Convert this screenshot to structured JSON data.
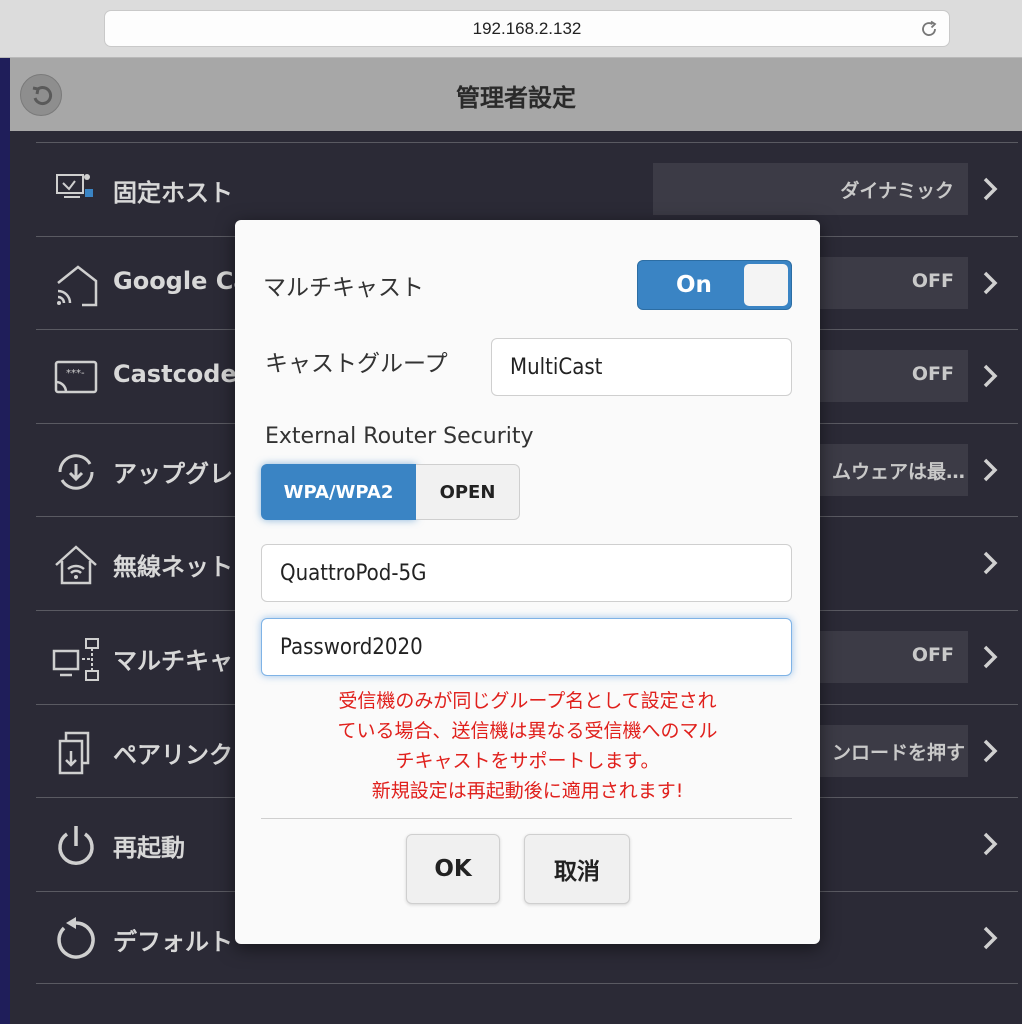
{
  "browser": {
    "url": "192.168.2.132"
  },
  "header": {
    "title": "管理者設定"
  },
  "settings": {
    "rows": [
      {
        "label": "固定ホスト",
        "value": "ダイナミック",
        "icon": "monitor-lock-icon"
      },
      {
        "label": "Google Ca",
        "value": "OFF",
        "icon": "home-cast-icon"
      },
      {
        "label": "Castcode",
        "value": "OFF",
        "icon": "cast-code-icon"
      },
      {
        "label": "アップグレ",
        "value": "ムウェアは最…",
        "icon": "refresh-download-icon"
      },
      {
        "label": "無線ネット",
        "value": "",
        "icon": "home-wifi-icon"
      },
      {
        "label": "マルチキャ",
        "value": "OFF",
        "icon": "network-devices-icon"
      },
      {
        "label": "ペアリンク",
        "value": "ンロードを押す",
        "icon": "pairing-download-icon"
      },
      {
        "label": "再起動",
        "value": "",
        "icon": "power-icon"
      },
      {
        "label": "デフォルト",
        "value": "",
        "icon": "reset-icon"
      }
    ]
  },
  "modal": {
    "multicast_label": "マルチキャスト",
    "multicast_toggle": "On",
    "cast_group_label": "キャストグループ",
    "cast_group_value": "MultiCast",
    "router_security_label": "External Router Security",
    "security_options": [
      "WPA/WPA2",
      "OPEN"
    ],
    "security_selected": "WPA/WPA2",
    "ssid_value": "QuattroPod-5G",
    "password_value": "Password2020",
    "warning_lines": [
      "受信機のみが同じグループ名として設定され",
      "ている場合、送信機は異なる受信機へのマル",
      "チキャストをサポートします。",
      "新規設定は再起動後に適用されます!"
    ],
    "ok_label": "OK",
    "cancel_label": "取消"
  },
  "colors": {
    "accent": "#3a84c4",
    "warning": "#e0201c",
    "background": "#2b2a36",
    "header": "#a7a7a7"
  }
}
